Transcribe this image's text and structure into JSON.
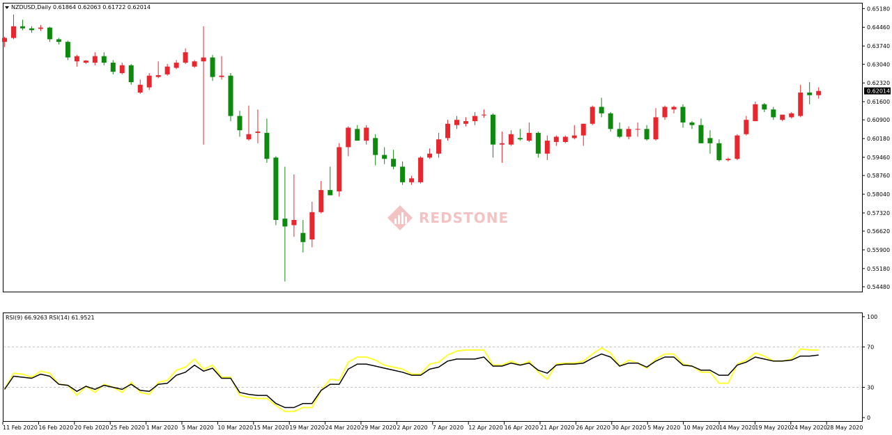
{
  "header": {
    "symbol": "NZDUSD,Daily",
    "ohlc": "0.61864 0.62063 0.61722 0.62014",
    "menu_icon": "triangle-down-icon"
  },
  "current_price": "0.62014",
  "watermark": {
    "text": "REDSTONE",
    "icon": "redstone-logo-icon",
    "color": "#e98f8f"
  },
  "colors": {
    "bull": "#e8262d",
    "bear": "#0d8a0d",
    "rsi9": "#ffff33",
    "rsi14": "#000000",
    "level_line": "#c0c0c0",
    "price_badge": "#000000"
  },
  "price_axis_labels": [
    "0.65180",
    "0.64460",
    "0.63740",
    "0.63040",
    "0.62320",
    "0.61600",
    "0.60900",
    "0.60180",
    "0.59460",
    "0.58760",
    "0.58040",
    "0.57320",
    "0.56620",
    "0.55900",
    "0.55180",
    "0.54480"
  ],
  "date_labels": [
    "11 Feb 2020",
    "16 Feb 2020",
    "20 Feb 2020",
    "25 Feb 2020",
    "1 Mar 2020",
    "5 Mar 2020",
    "10 Mar 2020",
    "15 Mar 2020",
    "19 Mar 2020",
    "24 Mar 2020",
    "29 Mar 2020",
    "2 Apr 2020",
    "7 Apr 2020",
    "12 Apr 2020",
    "16 Apr 2020",
    "21 Apr 2020",
    "26 Apr 2020",
    "30 Apr 2020",
    "5 May 2020",
    "10 May 2020",
    "14 May 2020",
    "19 May 2020",
    "24 May 2020",
    "28 May 2020"
  ],
  "rsi": {
    "title": "RSI(9) 66.9263  RSI(14) 61.9521",
    "axis_labels": [
      "100",
      "70",
      "30",
      "0"
    ],
    "levels": [
      70,
      30
    ],
    "ylim": [
      0,
      100
    ]
  },
  "chart_data": [
    {
      "type": "candlestick",
      "ylim": [
        0.5432,
        0.6535
      ],
      "candles": [
        {
          "o": 0.639,
          "h": 0.641,
          "l": 0.637,
          "c": 0.6405
        },
        {
          "o": 0.6405,
          "h": 0.6495,
          "l": 0.64,
          "c": 0.645
        },
        {
          "o": 0.645,
          "h": 0.6475,
          "l": 0.6435,
          "c": 0.6442
        },
        {
          "o": 0.6442,
          "h": 0.645,
          "l": 0.6425,
          "c": 0.6435
        },
        {
          "o": 0.644,
          "h": 0.6455,
          "l": 0.6432,
          "c": 0.6445
        },
        {
          "o": 0.6445,
          "h": 0.6448,
          "l": 0.639,
          "c": 0.64
        },
        {
          "o": 0.64,
          "h": 0.6405,
          "l": 0.638,
          "c": 0.639
        },
        {
          "o": 0.639,
          "h": 0.6395,
          "l": 0.632,
          "c": 0.633
        },
        {
          "o": 0.6315,
          "h": 0.634,
          "l": 0.6295,
          "c": 0.6335
        },
        {
          "o": 0.631,
          "h": 0.632,
          "l": 0.6305,
          "c": 0.6318
        },
        {
          "o": 0.631,
          "h": 0.635,
          "l": 0.63,
          "c": 0.6335
        },
        {
          "o": 0.6335,
          "h": 0.635,
          "l": 0.63,
          "c": 0.631
        },
        {
          "o": 0.631,
          "h": 0.632,
          "l": 0.6265,
          "c": 0.6275
        },
        {
          "o": 0.627,
          "h": 0.631,
          "l": 0.6265,
          "c": 0.63
        },
        {
          "o": 0.63,
          "h": 0.6305,
          "l": 0.6225,
          "c": 0.6235
        },
        {
          "o": 0.6195,
          "h": 0.6245,
          "l": 0.619,
          "c": 0.6225
        },
        {
          "o": 0.6215,
          "h": 0.627,
          "l": 0.6205,
          "c": 0.626
        },
        {
          "o": 0.6255,
          "h": 0.6315,
          "l": 0.625,
          "c": 0.6262
        },
        {
          "o": 0.6265,
          "h": 0.6305,
          "l": 0.626,
          "c": 0.6295
        },
        {
          "o": 0.629,
          "h": 0.632,
          "l": 0.6285,
          "c": 0.631
        },
        {
          "o": 0.631,
          "h": 0.6365,
          "l": 0.6305,
          "c": 0.635
        },
        {
          "o": 0.6295,
          "h": 0.632,
          "l": 0.629,
          "c": 0.6315
        },
        {
          "o": 0.6315,
          "h": 0.645,
          "l": 0.5995,
          "c": 0.633
        },
        {
          "o": 0.633,
          "h": 0.634,
          "l": 0.624,
          "c": 0.6255
        },
        {
          "o": 0.6255,
          "h": 0.6335,
          "l": 0.6245,
          "c": 0.626
        },
        {
          "o": 0.626,
          "h": 0.627,
          "l": 0.6085,
          "c": 0.6105
        },
        {
          "o": 0.6105,
          "h": 0.6125,
          "l": 0.6025,
          "c": 0.605
        },
        {
          "o": 0.6015,
          "h": 0.6145,
          "l": 0.601,
          "c": 0.6035
        },
        {
          "o": 0.604,
          "h": 0.613,
          "l": 0.6,
          "c": 0.6045
        },
        {
          "o": 0.604,
          "h": 0.6095,
          "l": 0.5925,
          "c": 0.594
        },
        {
          "o": 0.5945,
          "h": 0.595,
          "l": 0.5685,
          "c": 0.5705
        },
        {
          "o": 0.571,
          "h": 0.591,
          "l": 0.5468,
          "c": 0.568
        },
        {
          "o": 0.5685,
          "h": 0.588,
          "l": 0.564,
          "c": 0.5705
        },
        {
          "o": 0.5655,
          "h": 0.5705,
          "l": 0.558,
          "c": 0.562
        },
        {
          "o": 0.563,
          "h": 0.5775,
          "l": 0.56,
          "c": 0.5735
        },
        {
          "o": 0.5735,
          "h": 0.5855,
          "l": 0.573,
          "c": 0.582
        },
        {
          "o": 0.582,
          "h": 0.591,
          "l": 0.58,
          "c": 0.58
        },
        {
          "o": 0.5815,
          "h": 0.6,
          "l": 0.5795,
          "c": 0.5985
        },
        {
          "o": 0.5985,
          "h": 0.6065,
          "l": 0.595,
          "c": 0.606
        },
        {
          "o": 0.6055,
          "h": 0.607,
          "l": 0.601,
          "c": 0.601
        },
        {
          "o": 0.601,
          "h": 0.607,
          "l": 0.5995,
          "c": 0.606
        },
        {
          "o": 0.602,
          "h": 0.6035,
          "l": 0.5915,
          "c": 0.5955
        },
        {
          "o": 0.5955,
          "h": 0.5985,
          "l": 0.592,
          "c": 0.594
        },
        {
          "o": 0.594,
          "h": 0.5975,
          "l": 0.59,
          "c": 0.591
        },
        {
          "o": 0.591,
          "h": 0.593,
          "l": 0.584,
          "c": 0.585
        },
        {
          "o": 0.585,
          "h": 0.5875,
          "l": 0.584,
          "c": 0.5865
        },
        {
          "o": 0.585,
          "h": 0.595,
          "l": 0.5845,
          "c": 0.5945
        },
        {
          "o": 0.5945,
          "h": 0.598,
          "l": 0.594,
          "c": 0.596
        },
        {
          "o": 0.596,
          "h": 0.604,
          "l": 0.5945,
          "c": 0.6015
        },
        {
          "o": 0.602,
          "h": 0.609,
          "l": 0.601,
          "c": 0.6075
        },
        {
          "o": 0.607,
          "h": 0.6105,
          "l": 0.6055,
          "c": 0.609
        },
        {
          "o": 0.6075,
          "h": 0.61,
          "l": 0.6065,
          "c": 0.6085
        },
        {
          "o": 0.6085,
          "h": 0.612,
          "l": 0.607,
          "c": 0.6105
        },
        {
          "o": 0.6108,
          "h": 0.613,
          "l": 0.6098,
          "c": 0.611
        },
        {
          "o": 0.611,
          "h": 0.6115,
          "l": 0.5945,
          "c": 0.5995
        },
        {
          "o": 0.5995,
          "h": 0.6045,
          "l": 0.5925,
          "c": 0.6
        },
        {
          "o": 0.5995,
          "h": 0.605,
          "l": 0.599,
          "c": 0.6035
        },
        {
          "o": 0.602,
          "h": 0.6055,
          "l": 0.601,
          "c": 0.6015
        },
        {
          "o": 0.601,
          "h": 0.608,
          "l": 0.6005,
          "c": 0.604
        },
        {
          "o": 0.604,
          "h": 0.6045,
          "l": 0.5945,
          "c": 0.596
        },
        {
          "o": 0.596,
          "h": 0.603,
          "l": 0.5935,
          "c": 0.601
        },
        {
          "o": 0.6005,
          "h": 0.603,
          "l": 0.599,
          "c": 0.6025
        },
        {
          "o": 0.6005,
          "h": 0.603,
          "l": 0.6,
          "c": 0.6025
        },
        {
          "o": 0.602,
          "h": 0.607,
          "l": 0.6015,
          "c": 0.603
        },
        {
          "o": 0.603,
          "h": 0.6075,
          "l": 0.599,
          "c": 0.6075
        },
        {
          "o": 0.6075,
          "h": 0.6145,
          "l": 0.607,
          "c": 0.614
        },
        {
          "o": 0.614,
          "h": 0.6175,
          "l": 0.61,
          "c": 0.6115
        },
        {
          "o": 0.6115,
          "h": 0.612,
          "l": 0.6045,
          "c": 0.6055
        },
        {
          "o": 0.6055,
          "h": 0.608,
          "l": 0.602,
          "c": 0.6025
        },
        {
          "o": 0.6025,
          "h": 0.6065,
          "l": 0.6015,
          "c": 0.6055
        },
        {
          "o": 0.6055,
          "h": 0.608,
          "l": 0.6025,
          "c": 0.6055
        },
        {
          "o": 0.6055,
          "h": 0.607,
          "l": 0.601,
          "c": 0.6015
        },
        {
          "o": 0.6015,
          "h": 0.6135,
          "l": 0.601,
          "c": 0.61
        },
        {
          "o": 0.61,
          "h": 0.6145,
          "l": 0.609,
          "c": 0.614
        },
        {
          "o": 0.613,
          "h": 0.6145,
          "l": 0.6115,
          "c": 0.614
        },
        {
          "o": 0.614,
          "h": 0.615,
          "l": 0.606,
          "c": 0.608
        },
        {
          "o": 0.608,
          "h": 0.6085,
          "l": 0.6055,
          "c": 0.607
        },
        {
          "o": 0.607,
          "h": 0.6095,
          "l": 0.605,
          "c": 0.6
        },
        {
          "o": 0.602,
          "h": 0.605,
          "l": 0.596,
          "c": 0.6
        },
        {
          "o": 0.6,
          "h": 0.6015,
          "l": 0.593,
          "c": 0.5935
        },
        {
          "o": 0.5935,
          "h": 0.5945,
          "l": 0.593,
          "c": 0.594
        },
        {
          "o": 0.594,
          "h": 0.6035,
          "l": 0.5935,
          "c": 0.603
        },
        {
          "o": 0.6035,
          "h": 0.6105,
          "l": 0.603,
          "c": 0.609
        },
        {
          "o": 0.6085,
          "h": 0.616,
          "l": 0.6085,
          "c": 0.615
        },
        {
          "o": 0.615,
          "h": 0.6155,
          "l": 0.612,
          "c": 0.613
        },
        {
          "o": 0.613,
          "h": 0.614,
          "l": 0.609,
          "c": 0.61
        },
        {
          "o": 0.609,
          "h": 0.611,
          "l": 0.6085,
          "c": 0.611
        },
        {
          "o": 0.61,
          "h": 0.612,
          "l": 0.6095,
          "c": 0.6115
        },
        {
          "o": 0.6105,
          "h": 0.6225,
          "l": 0.61,
          "c": 0.6195
        },
        {
          "o": 0.6195,
          "h": 0.6235,
          "l": 0.615,
          "c": 0.6185
        },
        {
          "o": 0.6185,
          "h": 0.6215,
          "l": 0.6172,
          "c": 0.6201
        }
      ]
    },
    {
      "type": "line",
      "title": "RSI(9) 66.9263  RSI(14) 61.9521",
      "ylim": [
        0,
        100
      ],
      "series": [
        {
          "name": "RSI(9)",
          "values": [
            28,
            44,
            43,
            40,
            46,
            44,
            33,
            32,
            22,
            31,
            25,
            33,
            30,
            25,
            35,
            25,
            23,
            35,
            37,
            47,
            50,
            58,
            48,
            52,
            40,
            40,
            22,
            20,
            19,
            19,
            12,
            6,
            6,
            10,
            10,
            27,
            38,
            37,
            55,
            60,
            60,
            57,
            52,
            50,
            48,
            43,
            43,
            53,
            55,
            62,
            66,
            67,
            67,
            67,
            52,
            52,
            56,
            52,
            56,
            45,
            38,
            53,
            54,
            54,
            56,
            63,
            69,
            64,
            51,
            57,
            54,
            49,
            58,
            63,
            63,
            53,
            51,
            45,
            45,
            34,
            34,
            53,
            57,
            64,
            61,
            56,
            56,
            58,
            68,
            67,
            67
          ]
        },
        {
          "name": "RSI(14)",
          "values": [
            28,
            41,
            40,
            39,
            43,
            41,
            33,
            32,
            26,
            31,
            28,
            32,
            30,
            28,
            33,
            27,
            26,
            33,
            34,
            42,
            45,
            52,
            46,
            49,
            39,
            39,
            25,
            23,
            22,
            22,
            14,
            10,
            10,
            14,
            14,
            27,
            33,
            33,
            48,
            53,
            53,
            51,
            49,
            47,
            45,
            42,
            42,
            48,
            50,
            56,
            58,
            58,
            58,
            60,
            51,
            51,
            54,
            52,
            54,
            47,
            44,
            52,
            53,
            53,
            54,
            59,
            63,
            60,
            51,
            54,
            54,
            50,
            56,
            60,
            60,
            52,
            51,
            47,
            47,
            42,
            42,
            52,
            55,
            60,
            58,
            56,
            56,
            57,
            61,
            61,
            62
          ]
        }
      ]
    }
  ]
}
